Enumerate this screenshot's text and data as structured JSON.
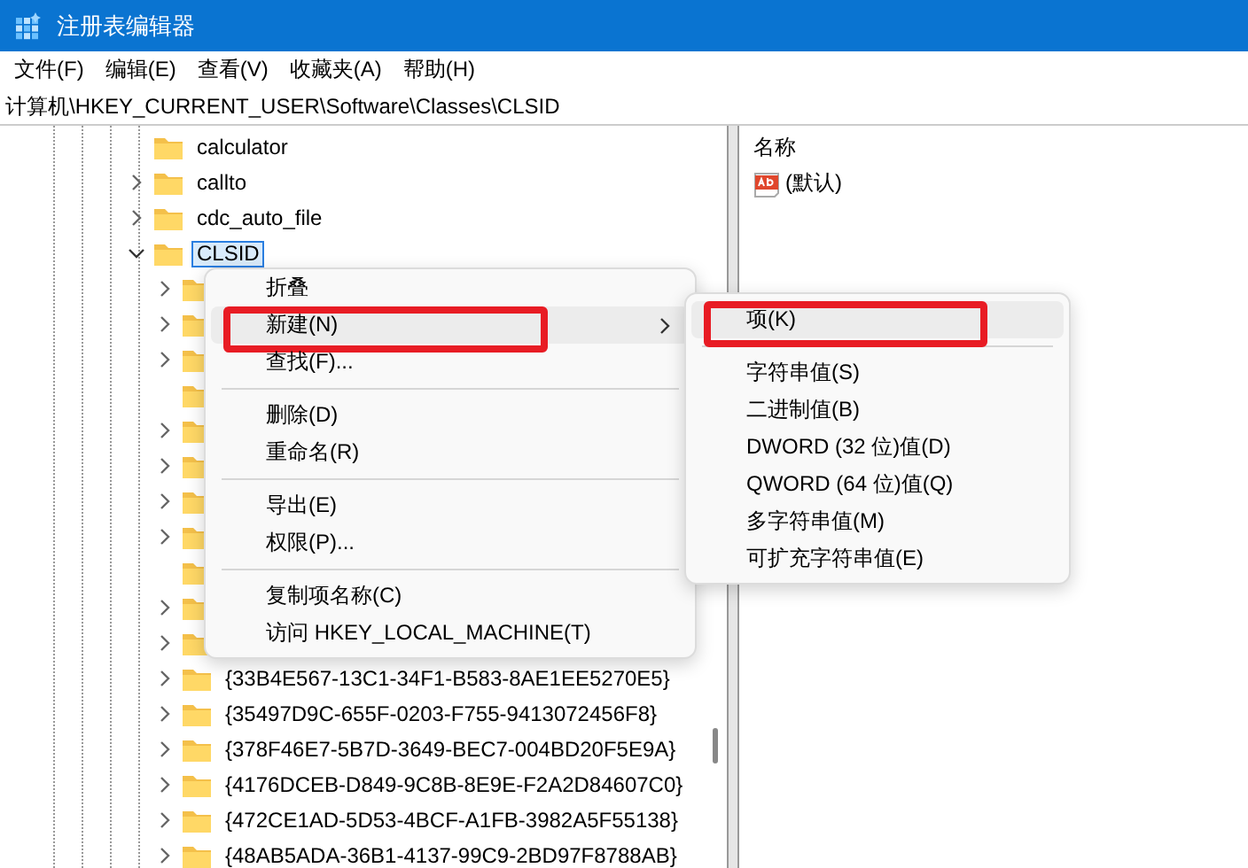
{
  "window": {
    "title": "注册表编辑器"
  },
  "menu_bar": [
    "文件(F)",
    "编辑(E)",
    "查看(V)",
    "收藏夹(A)",
    "帮助(H)"
  ],
  "address": "计算机\\HKEY_CURRENT_USER\\Software\\Classes\\CLSID",
  "tree": [
    {
      "name": "calculator",
      "expandable": false,
      "selected": false
    },
    {
      "name": "callto",
      "expandable": true,
      "expanded": false,
      "selected": false
    },
    {
      "name": "cdc_auto_file",
      "expandable": true,
      "expanded": false,
      "selected": false
    },
    {
      "name": "CLSID",
      "expandable": true,
      "expanded": true,
      "selected": true,
      "children": [
        {
          "expandable": true,
          "expanded": false
        },
        {
          "expandable": true,
          "expanded": false
        },
        {
          "expandable": true,
          "expanded": false
        },
        {
          "expandable": false
        },
        {
          "expandable": true,
          "expanded": false
        },
        {
          "expandable": true,
          "expanded": false
        },
        {
          "expandable": true,
          "expanded": false
        },
        {
          "expandable": true,
          "expanded": false
        },
        {
          "expandable": false
        },
        {
          "expandable": true,
          "expanded": false
        },
        {
          "expandable": true,
          "expanded": false
        },
        {
          "name": "{33B4E567-13C1-34F1-B583-8AE1EE5270E5}",
          "expandable": true,
          "expanded": false,
          "selected": false
        },
        {
          "name": "{35497D9C-655F-0203-F755-9413072456F8}",
          "expandable": true,
          "expanded": false,
          "selected": false
        },
        {
          "name": "{378F46E7-5B7D-3649-BEC7-004BD20F5E9A}",
          "expandable": true,
          "expanded": false,
          "selected": false
        },
        {
          "name": "{4176DCEB-D849-9C8B-8E9E-F2A2D84607C0}",
          "expandable": true,
          "expanded": false,
          "selected": false
        },
        {
          "name": "{472CE1AD-5D53-4BCF-A1FB-3982A5F55138}",
          "expandable": true,
          "expanded": false,
          "selected": false
        },
        {
          "name": "{48AB5ADA-36B1-4137-99C9-2BD97F8788AB}",
          "expandable": true,
          "expanded": false,
          "selected": false
        }
      ]
    }
  ],
  "values": {
    "columns": [
      "名称"
    ],
    "rows": [
      {
        "name": "(默认)"
      }
    ]
  },
  "context_menu": [
    {
      "kind": "item",
      "label": "折叠",
      "selected": false
    },
    {
      "kind": "item",
      "label": "新建(N)",
      "selected": true,
      "submenu": true,
      "marked": true
    },
    {
      "kind": "item",
      "label": "查找(F)...",
      "selected": false
    },
    {
      "kind": "separator"
    },
    {
      "kind": "item",
      "label": "删除(D)",
      "selected": false
    },
    {
      "kind": "item",
      "label": "重命名(R)",
      "selected": false
    },
    {
      "kind": "separator"
    },
    {
      "kind": "item",
      "label": "导出(E)",
      "selected": false
    },
    {
      "kind": "item",
      "label": "权限(P)...",
      "selected": false
    },
    {
      "kind": "separator"
    },
    {
      "kind": "item",
      "label": "复制项名称(C)",
      "selected": false
    },
    {
      "kind": "item",
      "label": "访问 HKEY_LOCAL_MACHINE(T)",
      "selected": false
    }
  ],
  "submenu": [
    {
      "kind": "item",
      "label": "项(K)",
      "selected": true,
      "marked": true
    },
    {
      "kind": "separator"
    },
    {
      "kind": "item",
      "label": "字符串值(S)",
      "selected": false
    },
    {
      "kind": "item",
      "label": "二进制值(B)",
      "selected": false
    },
    {
      "kind": "item",
      "label": "DWORD (32 位)值(D)",
      "selected": false
    },
    {
      "kind": "item",
      "label": "QWORD (64 位)值(Q)",
      "selected": false
    },
    {
      "kind": "item",
      "label": "多字符串值(M)",
      "selected": false
    },
    {
      "kind": "item",
      "label": "可扩充字符串值(E)",
      "selected": false
    }
  ]
}
